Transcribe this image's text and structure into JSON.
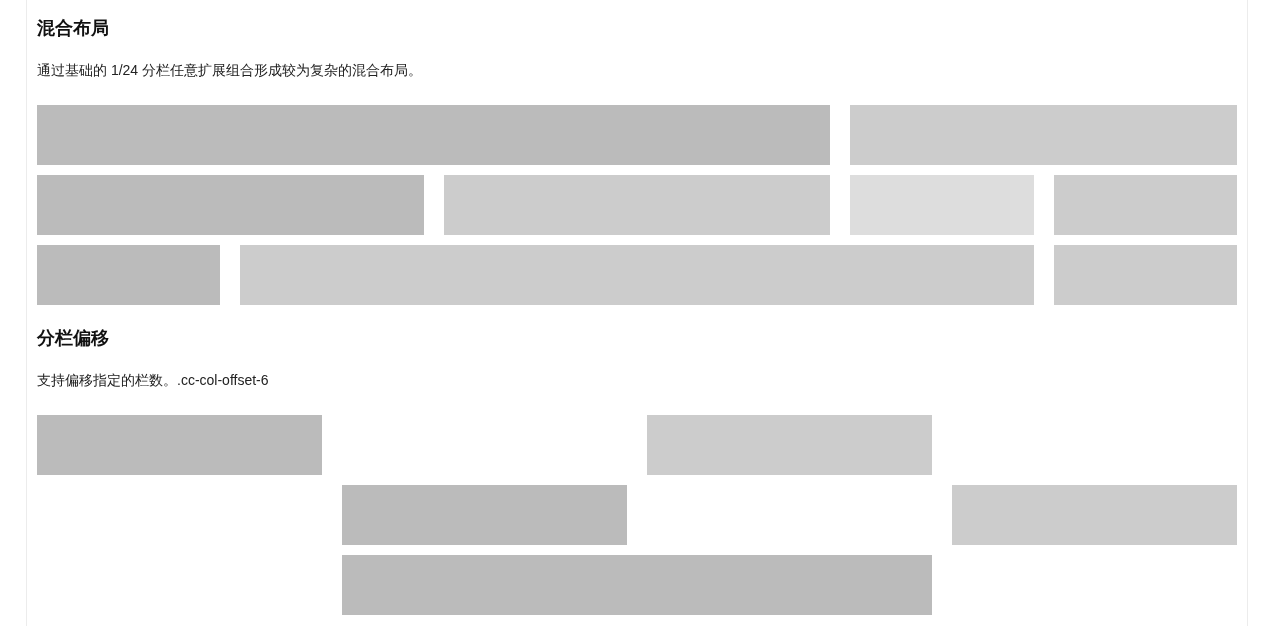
{
  "sections": [
    {
      "title": "混合布局",
      "description": "通过基础的 1/24 分栏任意扩展组合形成较为复杂的混合布局。",
      "rows": [
        {
          "blocks": [
            {
              "color": "#bbbbbb"
            },
            {
              "color": "#cccccc"
            }
          ]
        },
        {
          "blocks": [
            {
              "color": "#bbbbbb"
            },
            {
              "color": "#cccccc"
            },
            {
              "color": "#dddddd"
            },
            {
              "color": "#cccccc"
            }
          ]
        },
        {
          "blocks": [
            {
              "color": "#bbbbbb"
            },
            {
              "color": "#cccccc"
            },
            {
              "color": "#cccccc"
            }
          ]
        }
      ]
    },
    {
      "title": "分栏偏移",
      "description": "支持偏移指定的栏数。.cc-col-offset-6",
      "rows": [
        {
          "blocks": [
            {
              "color": "#bbbbbb"
            },
            {
              "color": "#cccccc"
            }
          ]
        },
        {
          "blocks": [
            {
              "color": "#bbbbbb"
            },
            {
              "color": "#cccccc"
            }
          ]
        },
        {
          "blocks": [
            {
              "color": "#bbbbbb"
            }
          ]
        }
      ]
    }
  ]
}
